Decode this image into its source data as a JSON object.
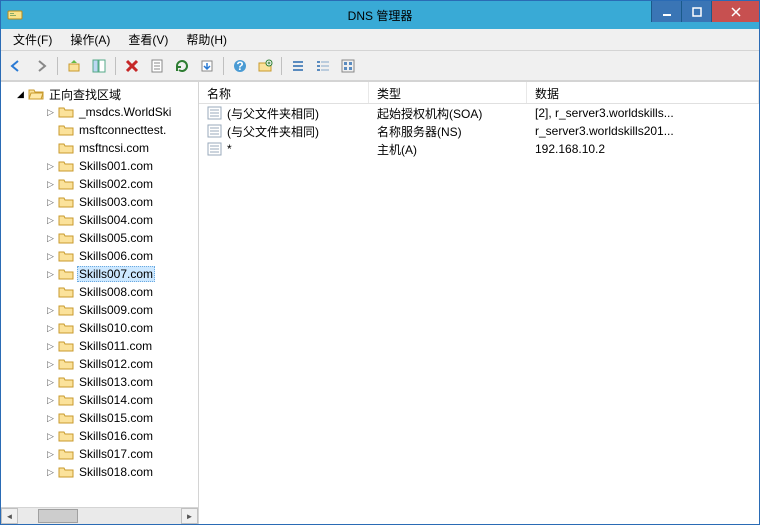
{
  "window": {
    "title": "DNS 管理器"
  },
  "menu": {
    "file": "文件(F)",
    "action": "操作(A)",
    "view": "查看(V)",
    "help": "帮助(H)"
  },
  "tree": {
    "root": "正向查找区域",
    "items": [
      {
        "label": "_msdcs.WorldSki",
        "expander": "▷",
        "indent": 2,
        "selected": false
      },
      {
        "label": "msftconnecttest.",
        "expander": "",
        "indent": 2,
        "selected": false
      },
      {
        "label": "msftncsi.com",
        "expander": "",
        "indent": 2,
        "selected": false
      },
      {
        "label": "Skills001.com",
        "expander": "▷",
        "indent": 2,
        "selected": false
      },
      {
        "label": "Skills002.com",
        "expander": "▷",
        "indent": 2,
        "selected": false
      },
      {
        "label": "Skills003.com",
        "expander": "▷",
        "indent": 2,
        "selected": false
      },
      {
        "label": "Skills004.com",
        "expander": "▷",
        "indent": 2,
        "selected": false
      },
      {
        "label": "Skills005.com",
        "expander": "▷",
        "indent": 2,
        "selected": false
      },
      {
        "label": "Skills006.com",
        "expander": "▷",
        "indent": 2,
        "selected": false
      },
      {
        "label": "Skills007.com",
        "expander": "▷",
        "indent": 2,
        "selected": true
      },
      {
        "label": "Skills008.com",
        "expander": "",
        "indent": 2,
        "selected": false
      },
      {
        "label": "Skills009.com",
        "expander": "▷",
        "indent": 2,
        "selected": false
      },
      {
        "label": "Skills010.com",
        "expander": "▷",
        "indent": 2,
        "selected": false
      },
      {
        "label": "Skills011.com",
        "expander": "▷",
        "indent": 2,
        "selected": false
      },
      {
        "label": "Skills012.com",
        "expander": "▷",
        "indent": 2,
        "selected": false
      },
      {
        "label": "Skills013.com",
        "expander": "▷",
        "indent": 2,
        "selected": false
      },
      {
        "label": "Skills014.com",
        "expander": "▷",
        "indent": 2,
        "selected": false
      },
      {
        "label": "Skills015.com",
        "expander": "▷",
        "indent": 2,
        "selected": false
      },
      {
        "label": "Skills016.com",
        "expander": "▷",
        "indent": 2,
        "selected": false
      },
      {
        "label": "Skills017.com",
        "expander": "▷",
        "indent": 2,
        "selected": false
      },
      {
        "label": "Skills018.com",
        "expander": "▷",
        "indent": 2,
        "selected": false
      }
    ]
  },
  "list": {
    "columns": {
      "name": "名称",
      "type": "类型",
      "data": "数据"
    },
    "rows": [
      {
        "name": "(与父文件夹相同)",
        "type": "起始授权机构(SOA)",
        "data": "[2], r_server3.worldskills..."
      },
      {
        "name": "(与父文件夹相同)",
        "type": "名称服务器(NS)",
        "data": "r_server3.worldskills201..."
      },
      {
        "name": "*",
        "type": "主机(A)",
        "data": "192.168.10.2"
      }
    ]
  }
}
